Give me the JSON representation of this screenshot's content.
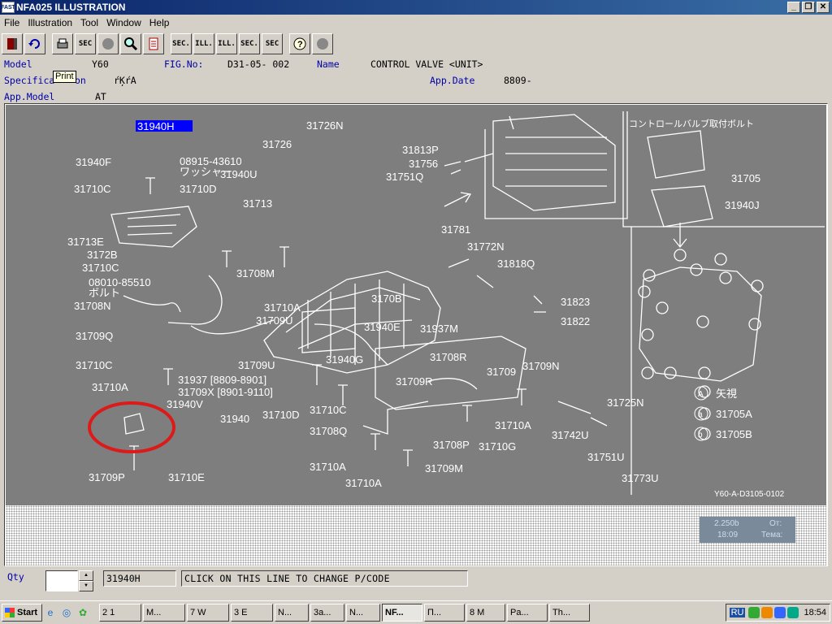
{
  "window": {
    "title": "NFA025 ILLUSTRATION",
    "app_icon_text": "FAST",
    "controls": [
      "_",
      "❐",
      "✕"
    ]
  },
  "menu": [
    "File",
    "Illustration",
    "Tool",
    "Window",
    "Help"
  ],
  "toolbar": {
    "buttons": [
      "exit",
      "undo",
      "print",
      "SEC",
      "circle",
      "find",
      "doc",
      "SEC.",
      "ILL.",
      "ILL.",
      "SEC.",
      "SEC",
      "help",
      "circle2"
    ],
    "tooltip": "Print"
  },
  "info": {
    "model_label": "Model",
    "model_value": "Y60",
    "fig_label": "FIG.No:",
    "fig_value": "D31-05- 002",
    "name_label": "Name",
    "name_value": "CONTROL VALVE <UNIT>",
    "spec_label_a": "Specifica",
    "spec_label_b": "on",
    "spec_value": "ŕĶŕA",
    "appdate_label": "App.Date",
    "appdate_value": "8809-",
    "appmodel_label": "App.Model",
    "appmodel_value": "AT"
  },
  "illustration": {
    "selected_part": "31940H",
    "part_labels": [
      "31726N",
      "31726",
      "31813P",
      "31756",
      "31751Q",
      "31940F",
      "08915-43610",
      "ワッシャー",
      "31940U",
      "31710C",
      "31710D",
      "31713",
      "31713E",
      "3172B",
      "31710C",
      "31708M",
      "08010-85510",
      "ボルト",
      "31708N",
      "31710A",
      "3170B",
      "31709U",
      "31940E",
      "31709Q",
      "31709U",
      "31940G",
      "31710C",
      "31937 [8809-8901]",
      "31709X [8901-9110]",
      "31710A",
      "31940V",
      "31940",
      "31710D",
      "31710C",
      "31709P",
      "31710E",
      "31708Q",
      "31710A",
      "31708P",
      "31709M",
      "31710A",
      "31781",
      "31772N",
      "31818Q",
      "31823",
      "31822",
      "31937M",
      "31708R",
      "31709R",
      "31709",
      "31709N",
      "31710A",
      "31710G",
      "31742U",
      "31725N",
      "31751U",
      "31773U",
      "31705",
      "31940J"
    ],
    "inset_title": "コントロールバルブ取付ボルト",
    "legend": [
      {
        "sym": "A",
        "text": "矢視"
      },
      {
        "sym": "a",
        "text": "31705A"
      },
      {
        "sym": "b",
        "text": "31705B"
      }
    ],
    "figure_code": "Y60-A-D3105-0102"
  },
  "notification": {
    "line1": "2.250b",
    "line2": "18:09",
    "from_label": "От:",
    "subject_label": "Тема:"
  },
  "bottom": {
    "qty_label": "Qty",
    "qty_value": "",
    "part_code": "31940H",
    "message": "CLICK ON THIS LINE TO CHANGE P/CODE"
  },
  "taskbar": {
    "start_label": "Start",
    "buttons": [
      "2 1",
      "M...",
      "7 W",
      "3 E",
      "N...",
      "3a...",
      "N...",
      "NF...",
      "П...",
      "8 M",
      "Pa...",
      "Th..."
    ],
    "active_index": 7,
    "lang": "RU",
    "clock": "18:54"
  },
  "colors": {
    "title_bar": "#0a246a",
    "illustration_bg": "#7e7e7e",
    "selection": "#0000ff",
    "highlight_circle": "#dd1a1a",
    "label_blue": "#0000aa"
  }
}
